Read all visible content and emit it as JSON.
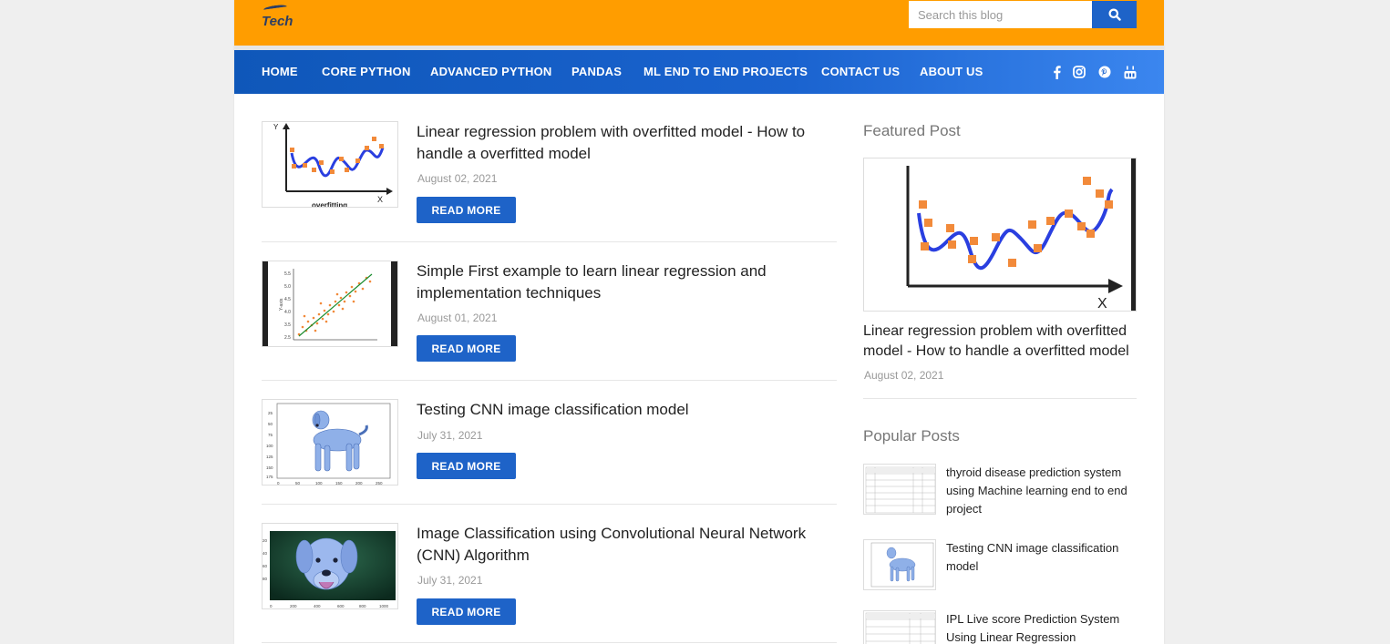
{
  "header": {
    "logo_text": "Tech",
    "search": {
      "placeholder": "Search this blog"
    }
  },
  "nav": {
    "items": [
      "HOME",
      "CORE PYTHON",
      "ADVANCED PYTHON",
      "PANDAS",
      "ML END TO END PROJECTS",
      "CONTACT US",
      "ABOUT US"
    ],
    "social": [
      "facebook-icon",
      "instagram-icon",
      "pinterest-icon",
      "youtube-icon"
    ]
  },
  "posts": [
    {
      "title": "Linear regression problem with overfitted model - How to handle a overfitted model",
      "date": "August 02, 2021",
      "button": "READ MORE",
      "thumb_caption": "overfitting"
    },
    {
      "title": "Simple First example to learn linear regression and implementation techniques",
      "date": "August 01, 2021",
      "button": "READ MORE"
    },
    {
      "title": "Testing CNN image classification model",
      "date": "July 31, 2021",
      "button": "READ MORE"
    },
    {
      "title": "Image Classification using Convolutional Neural Network (CNN) Algorithm",
      "date": "July 31, 2021",
      "button": "READ MORE"
    }
  ],
  "sidebar": {
    "featured": {
      "heading": "Featured Post",
      "title": "Linear regression problem with overfitted model - How to handle a overfitted model",
      "date": "August 02, 2021"
    },
    "popular": {
      "heading": "Popular Posts",
      "items": [
        {
          "title": "thyroid disease prediction system using Machine learning end to end project"
        },
        {
          "title": "Testing CNN image classification model"
        },
        {
          "title": "IPL Live score Prediction System Using Linear Regression"
        }
      ]
    }
  },
  "colors": {
    "header_orange": "#ff9d00",
    "nav_blue": "#1a63cf",
    "button_blue": "#1e63c8"
  }
}
